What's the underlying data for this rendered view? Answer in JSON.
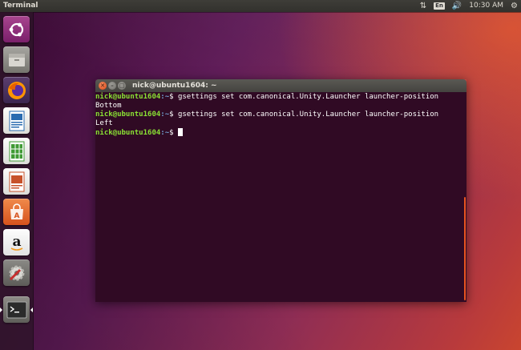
{
  "top_panel": {
    "app_name": "Terminal",
    "keyboard_layout": "En",
    "time": "10:30 AM",
    "icons": [
      "network-icon",
      "keyboard-indicator",
      "volume-icon",
      "gear-icon"
    ]
  },
  "launcher": {
    "items": [
      {
        "name": "ubuntu-dash-icon",
        "color": "#8e2b7e"
      },
      {
        "name": "files-icon",
        "color": "#8b8b86"
      },
      {
        "name": "firefox-icon",
        "color": "#e66000"
      },
      {
        "name": "libreoffice-writer-icon",
        "color": "#2a6bb0"
      },
      {
        "name": "libreoffice-calc-icon",
        "color": "#3f9a34"
      },
      {
        "name": "libreoffice-impress-icon",
        "color": "#c7522a"
      },
      {
        "name": "software-center-icon",
        "color": "#e8642b"
      },
      {
        "name": "amazon-icon",
        "color": "#eeeeee"
      },
      {
        "name": "system-settings-icon",
        "color": "#b83232"
      },
      {
        "name": "terminal-icon",
        "color": "#2b2b2b"
      }
    ]
  },
  "terminal": {
    "title": "nick@ubuntu1604: ~",
    "lines": [
      {
        "user": "nick@ubuntu1604",
        "path": ":~",
        "symbol": "$ ",
        "command": "gsettings set com.canonical.Unity.Launcher launcher-position"
      },
      {
        "output": "Bottom"
      },
      {
        "user": "nick@ubuntu1604",
        "path": ":~",
        "symbol": "$ ",
        "command": "gsettings set com.canonical.Unity.Launcher launcher-position"
      },
      {
        "output": "Left"
      },
      {
        "user": "nick@ubuntu1604",
        "path": ":~",
        "symbol": "$ ",
        "command": ""
      }
    ]
  },
  "colors": {
    "accent": "#e95420",
    "terminal_bg": "#300a24",
    "prompt_user": "#8ae234",
    "prompt_path": "#729fcf"
  }
}
